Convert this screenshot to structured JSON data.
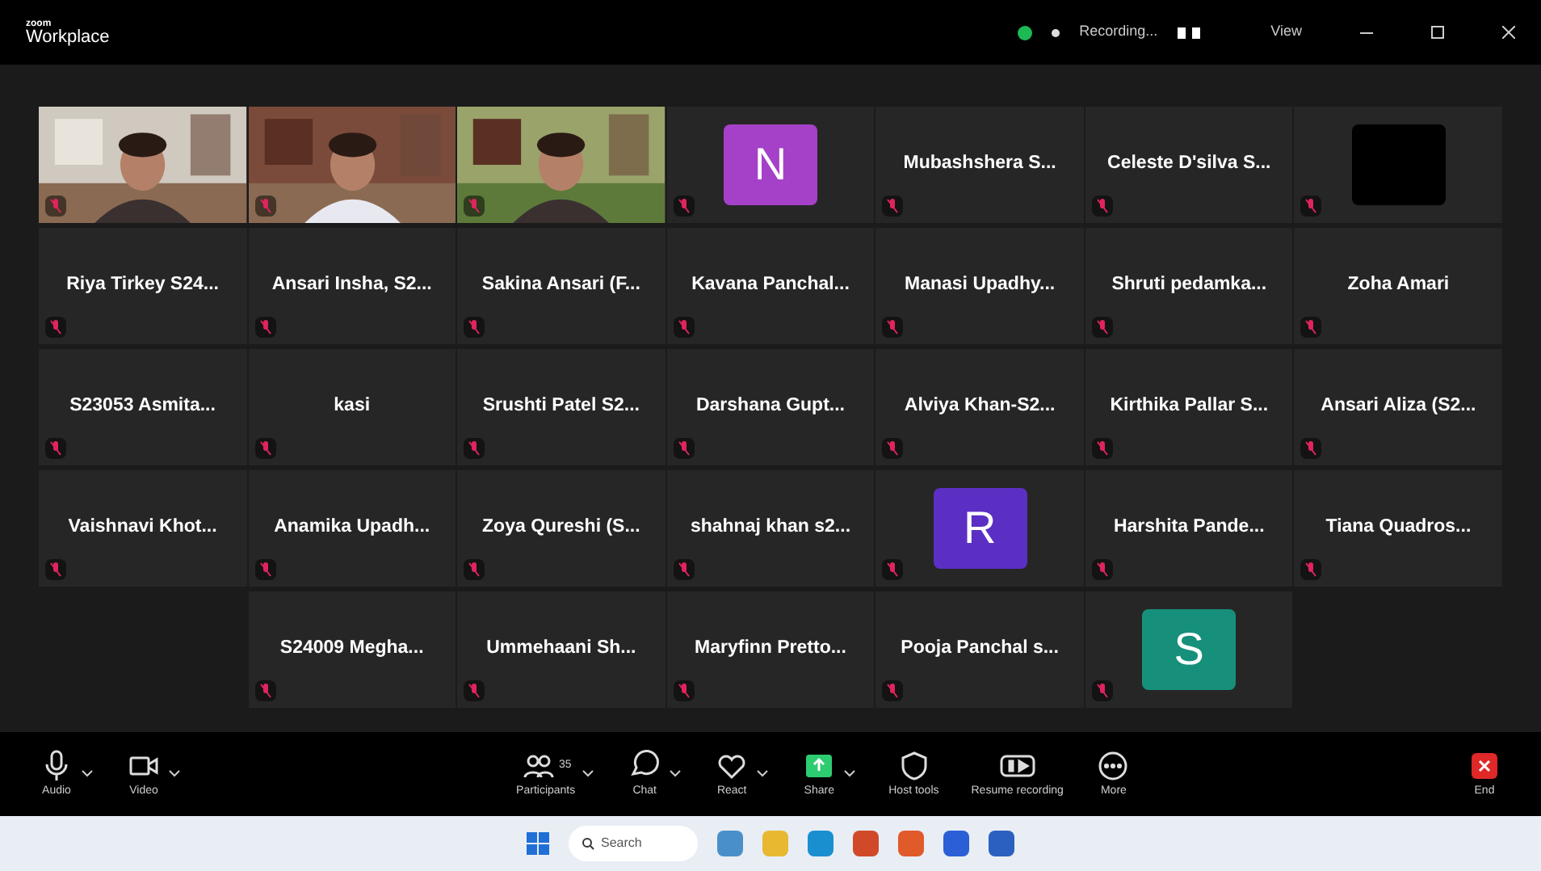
{
  "window": {
    "brand_small": "zoom",
    "title": "Workplace",
    "recording": "Recording...",
    "view": "View"
  },
  "rows": [
    {
      "tiles": [
        {
          "kind": "video"
        },
        {
          "kind": "video"
        },
        {
          "kind": "video"
        },
        {
          "kind": "avatar",
          "letter": "N",
          "color": "#a541c8"
        },
        {
          "kind": "name",
          "name": "Mubashshera S..."
        },
        {
          "kind": "name",
          "name": "Celeste D'silva S..."
        },
        {
          "kind": "blank"
        }
      ]
    },
    {
      "tiles": [
        {
          "kind": "name",
          "name": "Riya Tirkey S24..."
        },
        {
          "kind": "name",
          "name": "Ansari Insha, S2..."
        },
        {
          "kind": "name",
          "name": "Sakina Ansari (F..."
        },
        {
          "kind": "name",
          "name": "Kavana Panchal..."
        },
        {
          "kind": "name",
          "name": "Manasi Upadhy..."
        },
        {
          "kind": "name",
          "name": "Shruti pedamka..."
        },
        {
          "kind": "name",
          "name": "Zoha Amari"
        }
      ]
    },
    {
      "tiles": [
        {
          "kind": "name",
          "name": "S23053 Asmita..."
        },
        {
          "kind": "name",
          "name": "kasi"
        },
        {
          "kind": "name",
          "name": "Srushti Patel S2..."
        },
        {
          "kind": "name",
          "name": "Darshana Gupt..."
        },
        {
          "kind": "name",
          "name": "Alviya Khan-S2..."
        },
        {
          "kind": "name",
          "name": "Kirthika Pallar S..."
        },
        {
          "kind": "name",
          "name": "Ansari Aliza (S2..."
        }
      ]
    },
    {
      "tiles": [
        {
          "kind": "name",
          "name": "Vaishnavi Khot..."
        },
        {
          "kind": "name",
          "name": "Anamika Upadh..."
        },
        {
          "kind": "name",
          "name": "Zoya Qureshi (S..."
        },
        {
          "kind": "name",
          "name": "shahnaj khan s2..."
        },
        {
          "kind": "avatar",
          "letter": "R",
          "color": "#5b2fc4"
        },
        {
          "kind": "name",
          "name": "Harshita Pande..."
        },
        {
          "kind": "name",
          "name": "Tiana Quadros..."
        }
      ]
    },
    {
      "tiles": [
        {
          "kind": "empty"
        },
        {
          "kind": "name",
          "name": "S24009 Megha..."
        },
        {
          "kind": "name",
          "name": "Ummehaani Sh..."
        },
        {
          "kind": "name",
          "name": "Maryfinn Pretto..."
        },
        {
          "kind": "name",
          "name": "Pooja Panchal s..."
        },
        {
          "kind": "avatar",
          "letter": "S",
          "color": "#16907a"
        }
      ]
    }
  ],
  "toolbar": [
    {
      "kind": "mic",
      "label": "Audio",
      "caret": true
    },
    {
      "kind": "camera",
      "label": "Video",
      "caret": true
    },
    {
      "kind": "spacer"
    },
    {
      "kind": "people",
      "label": "Participants",
      "count": "35",
      "caret": true
    },
    {
      "kind": "chat",
      "label": "Chat",
      "caret": true
    },
    {
      "kind": "heart",
      "label": "React",
      "caret": true
    },
    {
      "kind": "share",
      "label": "Share",
      "caret": true
    },
    {
      "kind": "shield",
      "label": "Host tools",
      "caret": false
    },
    {
      "kind": "record",
      "label": "Resume recording",
      "caret": false
    },
    {
      "kind": "more",
      "label": "More",
      "caret": false
    },
    {
      "kind": "spacer"
    },
    {
      "kind": "end",
      "label": "End",
      "caret": false
    }
  ],
  "taskbar": {
    "search": "Search"
  }
}
